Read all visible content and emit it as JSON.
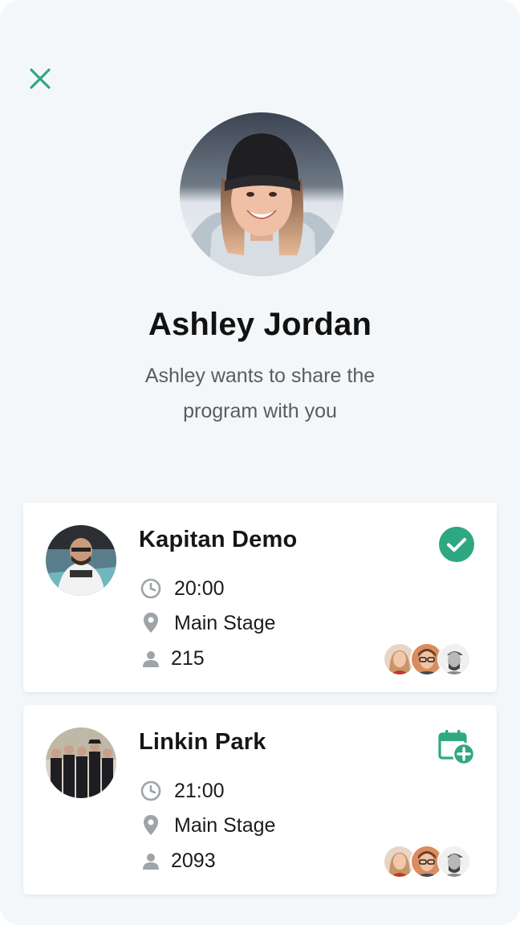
{
  "profile": {
    "name": "Ashley Jordan",
    "message": "Ashley wants to share the program with you"
  },
  "colors": {
    "accent": "#2fa882",
    "icon_gray": "#9ea4a8",
    "background": "#f4f7f9"
  },
  "events": [
    {
      "title": "Kapitan Demo",
      "time": "20:00",
      "location": "Main Stage",
      "attendees": "215",
      "status": "check-circle-icon"
    },
    {
      "title": "Linkin Park",
      "time": "21:00",
      "location": "Main Stage",
      "attendees": "2093",
      "status": "calendar-add-icon"
    }
  ]
}
